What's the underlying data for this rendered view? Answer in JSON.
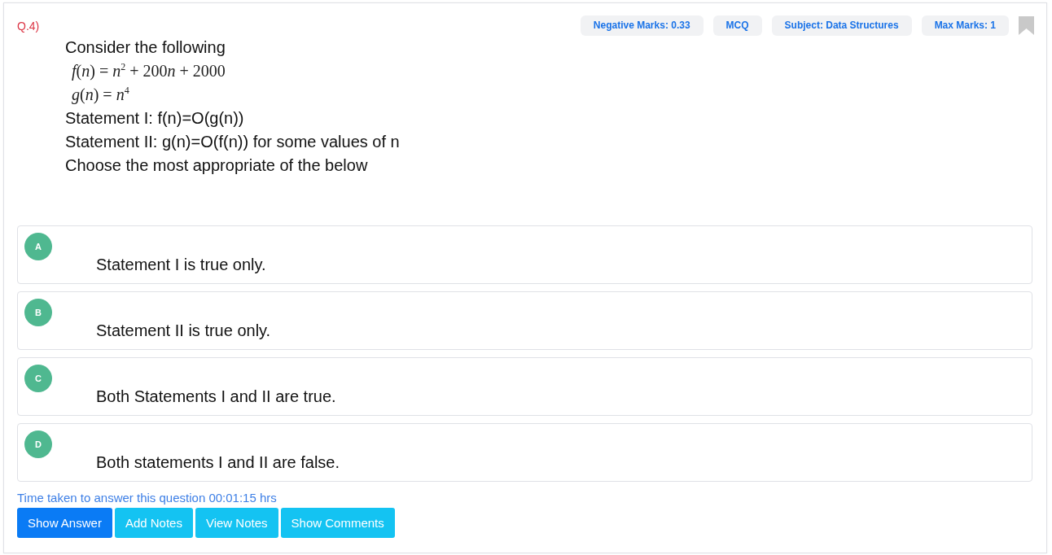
{
  "question": {
    "number": "Q.4)",
    "lines": [
      {
        "kind": "text",
        "text": "Consider the following"
      },
      {
        "kind": "formula",
        "text": "f(n) = n$^{2}$ + 200n + 2000"
      },
      {
        "kind": "formula",
        "text": "g(n) = n$^{4}$"
      },
      {
        "kind": "text",
        "text": "Statement I: f(n)=O(g(n))"
      },
      {
        "kind": "text",
        "text": "Statement II: g(n)=O(f(n)) for some values of n"
      },
      {
        "kind": "text",
        "text": "Choose the most appropriate of the below"
      }
    ]
  },
  "tags": [
    "Negative Marks: 0.33",
    "MCQ",
    "Subject: Data Structures",
    "Max Marks: 1"
  ],
  "bookmarked": false,
  "options": [
    {
      "letter": "A",
      "text": "Statement I is true only."
    },
    {
      "letter": "B",
      "text": "Statement II is true only."
    },
    {
      "letter": "C",
      "text": "Both Statements I and II are true."
    },
    {
      "letter": "D",
      "text": "Both statements I and II are false."
    }
  ],
  "time_taken": "Time taken to answer this question 00:01:15 hrs",
  "buttons": [
    {
      "label": "Show Answer",
      "kind": "primary"
    },
    {
      "label": "Add Notes",
      "kind": "info"
    },
    {
      "label": "View Notes",
      "kind": "info"
    },
    {
      "label": "Show Comments",
      "kind": "info"
    }
  ]
}
